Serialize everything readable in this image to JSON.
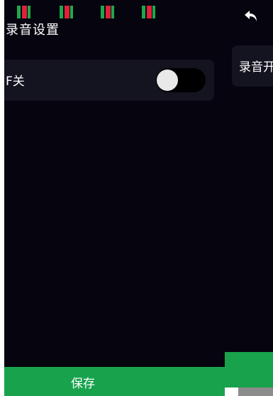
{
  "status_bar": {
    "signal_icons": [
      "signal-icon",
      "signal-icon",
      "signal-icon",
      "signal-icon"
    ]
  },
  "left_page": {
    "title": "录音设置",
    "switch_row": {
      "label": "开关",
      "visible_label": "F关",
      "toggle_state": "off"
    },
    "save_button": {
      "label": "保存"
    }
  },
  "right_page": {
    "back_icon": "back-arrow-icon",
    "card_label": "录音开"
  },
  "colors": {
    "background": "#05040f",
    "card": "#141320",
    "accent_green": "#18a24c",
    "signal_green": "#1fa84a",
    "signal_red": "#e0213a"
  }
}
